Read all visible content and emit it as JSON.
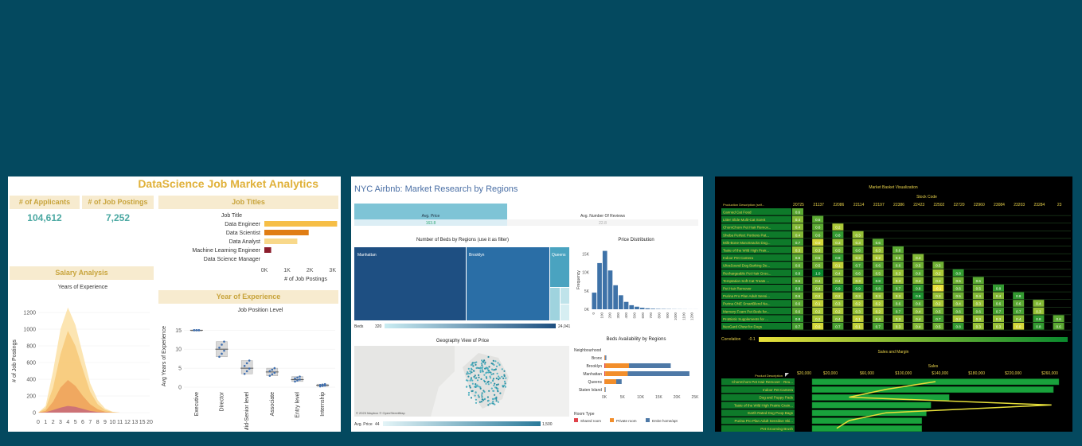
{
  "card1": {
    "title": "DataScience Job Market Analytics",
    "kpis": [
      {
        "label": "# of Applicants",
        "value": "104,612"
      },
      {
        "label": "# of Job Postings",
        "value": "7,252"
      }
    ],
    "job_titles": {
      "header": "Job Titles",
      "field_label": "Job Title",
      "axis_label": "# of Job Postings",
      "ticks": [
        "0K",
        "1K",
        "2K",
        "3K"
      ],
      "tick_values": [
        0,
        1000,
        2000,
        3000
      ],
      "rows": [
        {
          "label": "Data Engineer",
          "value": 3200,
          "color": "#f6be46"
        },
        {
          "label": "Data Scientist",
          "value": 1950,
          "color": "#e07d14"
        },
        {
          "label": "Data Analyst",
          "value": 1450,
          "color": "#f8d88a"
        },
        {
          "label": "Machine Learning Engineer",
          "value": 300,
          "color": "#8b1d2c"
        },
        {
          "label": "Data Science Manager",
          "value": 0,
          "color": "#cccccc"
        }
      ]
    },
    "salary": {
      "header": "Salary Analysis",
      "subtitle": "Years of Experience",
      "ylabel": "# of Job Postings",
      "yticks": [
        "1200",
        "1000",
        "800",
        "600",
        "400",
        "200",
        "0"
      ],
      "ytick_values": [
        1200,
        1000,
        800,
        600,
        400,
        200,
        0
      ],
      "xticks": [
        "0",
        "1",
        "2",
        "3",
        "4",
        "5",
        "6",
        "7",
        "8",
        "9",
        "10",
        "11",
        "12",
        "13",
        "15",
        "20"
      ],
      "series": [
        {
          "color": "#fbe0a4",
          "values": [
            0,
            80,
            500,
            1000,
            1260,
            1050,
            700,
            350,
            150,
            50,
            10,
            0,
            0,
            0,
            0,
            0
          ]
        },
        {
          "color": "#f7c978",
          "values": [
            0,
            50,
            300,
            700,
            980,
            800,
            520,
            250,
            100,
            30,
            8,
            0,
            0,
            0,
            0,
            0
          ]
        },
        {
          "color": "#eea15a",
          "values": [
            0,
            20,
            130,
            300,
            390,
            320,
            200,
            100,
            40,
            10,
            3,
            0,
            0,
            0,
            0,
            0
          ]
        },
        {
          "color": "#c7687a",
          "values": [
            0,
            5,
            30,
            60,
            80,
            70,
            45,
            20,
            8,
            2,
            0,
            0,
            0,
            0,
            0,
            0
          ]
        }
      ]
    },
    "experience": {
      "header": "Year of Experience",
      "subtitle": "Job Position Level",
      "ylabel": "Avg Years of Experience",
      "yticks": [
        "15",
        "10",
        "5",
        "0"
      ],
      "ytick_values": [
        15,
        10,
        5,
        0
      ],
      "categories": [
        "Executive",
        "Director",
        "Mid-Senior level",
        "Associate",
        "Entry level",
        "Internship"
      ],
      "medians": [
        15,
        10,
        5,
        4,
        2,
        0.5
      ],
      "q1": [
        15,
        8,
        3.5,
        3,
        1.5,
        0.2
      ],
      "q3": [
        15,
        12,
        7,
        5,
        2.8,
        0.8
      ]
    }
  },
  "card2": {
    "title": "NYC Airbnb: Market Research by Regions",
    "kpi_headers": [
      "Avg. Price",
      "Avg. Number Of Reviews"
    ],
    "kpi_values": [
      "163.8",
      "22.8"
    ],
    "treemap": {
      "title": "Number of Beds by Regions (use it as filter)",
      "regions": [
        "Manhattan",
        "Brooklyn",
        "Queens"
      ],
      "legend_label": "Beds",
      "legend_min": "320",
      "legend_max": "24,041"
    },
    "price_dist": {
      "title": "Price Distribution",
      "ylabel": "Frequency",
      "yticks": [
        "15K",
        "10K",
        "5K",
        "0K"
      ],
      "ytick_values": [
        15000,
        10000,
        5000,
        0
      ],
      "xticks": [
        "0",
        "100",
        "200",
        "300",
        "400",
        "500",
        "600",
        "700",
        "800",
        "900",
        "1000",
        "1100",
        "1200"
      ],
      "values": [
        4500,
        12500,
        15800,
        10500,
        6500,
        3800,
        2000,
        1100,
        700,
        400,
        250,
        150,
        100,
        80,
        60,
        40,
        30,
        20,
        10,
        10
      ]
    },
    "map": {
      "title": "Geography View of Price",
      "attribution": "© 2023 Mapbox © OpenStreetMap",
      "legend_label": "Avg. Price",
      "legend_min": "44",
      "legend_max": "1,500"
    },
    "beds": {
      "title": "Beds Availability by Regions",
      "field_label": "Neighbourhood",
      "regions": [
        "Bronx",
        "Brooklyn",
        "Manhattan",
        "Queens",
        "Staten Island"
      ],
      "shared": [
        60,
        300,
        250,
        80,
        10
      ],
      "private": [
        200,
        6500,
        6200,
        3200,
        150
      ],
      "entire": [
        300,
        11500,
        17000,
        1500,
        200
      ],
      "xticks": [
        "0K",
        "5K",
        "10K",
        "15K",
        "20K",
        "25K"
      ],
      "xtick_values": [
        0,
        5000,
        10000,
        15000,
        20000,
        25000
      ],
      "legend_title": "Room Type",
      "legend": [
        {
          "label": "Shared room",
          "color": "#e0424a"
        },
        {
          "label": "Private room",
          "color": "#f28e2b"
        },
        {
          "label": "Entire home/apt",
          "color": "#4e79a7"
        }
      ]
    }
  },
  "card3": {
    "title": "Market Basket Visualization",
    "stock_label": "Stock Code",
    "row_header": "Production Description (self...",
    "columns": [
      "20725",
      "21137",
      "22086",
      "22114",
      "22197",
      "22386",
      "22423",
      "22502",
      "22720",
      "22960",
      "23084",
      "23203",
      "23284",
      "23"
    ],
    "rows": [
      {
        "label": "Canned Cat Food",
        "cells": [
          0.6
        ]
      },
      {
        "label": "Litter Slide Multi-Cat Scent",
        "cells": [
          0.4,
          0.6
        ]
      },
      {
        "label": "ChomChom Pet Hair Remov...",
        "cells": [
          0.4,
          0.6,
          0.2
        ]
      },
      {
        "label": "Sheba Perfect Portions Pat...",
        "cells": [
          0.4,
          0.6,
          0.8,
          0.3
        ]
      },
      {
        "label": "Milk-Bone MaroSnacks Dog...",
        "cells": [
          0.7,
          0.0,
          0.3,
          0.3,
          0.6
        ]
      },
      {
        "label": "Taste of the Wild High Prair...",
        "cells": [
          0.3,
          0.3,
          0.5,
          0.6,
          0.3,
          0.6
        ]
      },
      {
        "label": "Indoor Pet Camera",
        "cells": [
          0.6,
          0.5,
          0.8,
          0.3,
          0.2,
          0.5,
          0.4
        ]
      },
      {
        "label": "UltraSound Dog Barking De...",
        "cells": [
          0.6,
          0.5,
          0.1,
          0.7,
          0.6,
          0.6,
          0.5,
          0.5
        ]
      },
      {
        "label": "Rechargeable Pet Hair Groo...",
        "cells": [
          0.8,
          1.0,
          0.4,
          0.6,
          0.5,
          0.3,
          0.6,
          0.2,
          0.8
        ]
      },
      {
        "label": "Temptation Soft Cat Treats ...",
        "cells": [
          0.6,
          0.4,
          0.4,
          0.3,
          0.8,
          0.3,
          0.4,
          0.3,
          0.5,
          0.6
        ]
      },
      {
        "label": "Pet Hair Remover",
        "cells": [
          0.8,
          0.4,
          0.9,
          0.9,
          0.8,
          0.7,
          0.8,
          -0.1,
          0.6,
          0.5,
          0.8
        ]
      },
      {
        "label": "Purina Pro Plan Adult Sensi...",
        "cells": [
          0.6,
          0.2,
          0.2,
          0.3,
          0.3,
          0.3,
          0.9,
          0.3,
          0.5,
          0.4,
          0.4,
          0.8
        ]
      },
      {
        "label": "Purina ONE SmartBlend Na...",
        "cells": [
          0.6,
          0.1,
          0.3,
          0.2,
          0.2,
          0.6,
          0.6,
          0.2,
          0.4,
          0.3,
          0.6,
          0.6,
          0.4
        ]
      },
      {
        "label": "Memory Foam Pet Beds for...",
        "cells": [
          0.6,
          0.2,
          0.2,
          0.3,
          0.2,
          0.7,
          0.4,
          0.5,
          0.6,
          0.6,
          0.7,
          0.7,
          0.3
        ]
      },
      {
        "label": "ProBiotic Supplements for ...",
        "cells": [
          0.8,
          0.2,
          0.4,
          0.1,
          0.4,
          0.3,
          0.4,
          0.7,
          0.2,
          0.3,
          0.3,
          0.4,
          0.8,
          0.6
        ]
      },
      {
        "label": "NexGard Chew for Dogs",
        "cells": [
          0.7,
          0.0,
          0.7,
          0.1,
          0.7,
          0.3,
          0.4,
          0.5,
          0.8,
          0.3,
          0.3,
          0.0,
          0.8,
          0.6
        ]
      }
    ],
    "correlation_label": "Correlation",
    "correlation_min": "-0.1",
    "sales_title": "Sales and Margin",
    "sales_label": "Sales",
    "sales_row_header": "Product Description",
    "sales_ticks": [
      "$20,000",
      "$20,000",
      "$60,000",
      "$100,000",
      "$140,000",
      "$180,000",
      "$220,000",
      "$260,000"
    ],
    "sales_tick_values": [
      0,
      20000,
      60000,
      100000,
      140000,
      180000,
      220000,
      260000
    ],
    "sales_rows": [
      {
        "label": "ChomChom Pet Hair Remover - Reu...",
        "value": 270000
      },
      {
        "label": "Indoor Pet Camera",
        "value": 264000
      },
      {
        "label": "Dog and Puppy Pads",
        "value": 150000
      },
      {
        "label": "Taste of the Wild High Prairie Grain...",
        "value": 130000
      },
      {
        "label": "Earth Rated Dog Poop Bags",
        "value": 125000
      },
      {
        "label": "Purina Pro Plan Adult Sensitive Ski...",
        "value": 120000
      },
      {
        "label": "Pet Grooming Brush",
        "value": 120000
      }
    ],
    "margin_line": [
      0.5,
      0.3,
      0.15,
      0.97,
      0.3,
      0.15,
      0.1
    ]
  }
}
